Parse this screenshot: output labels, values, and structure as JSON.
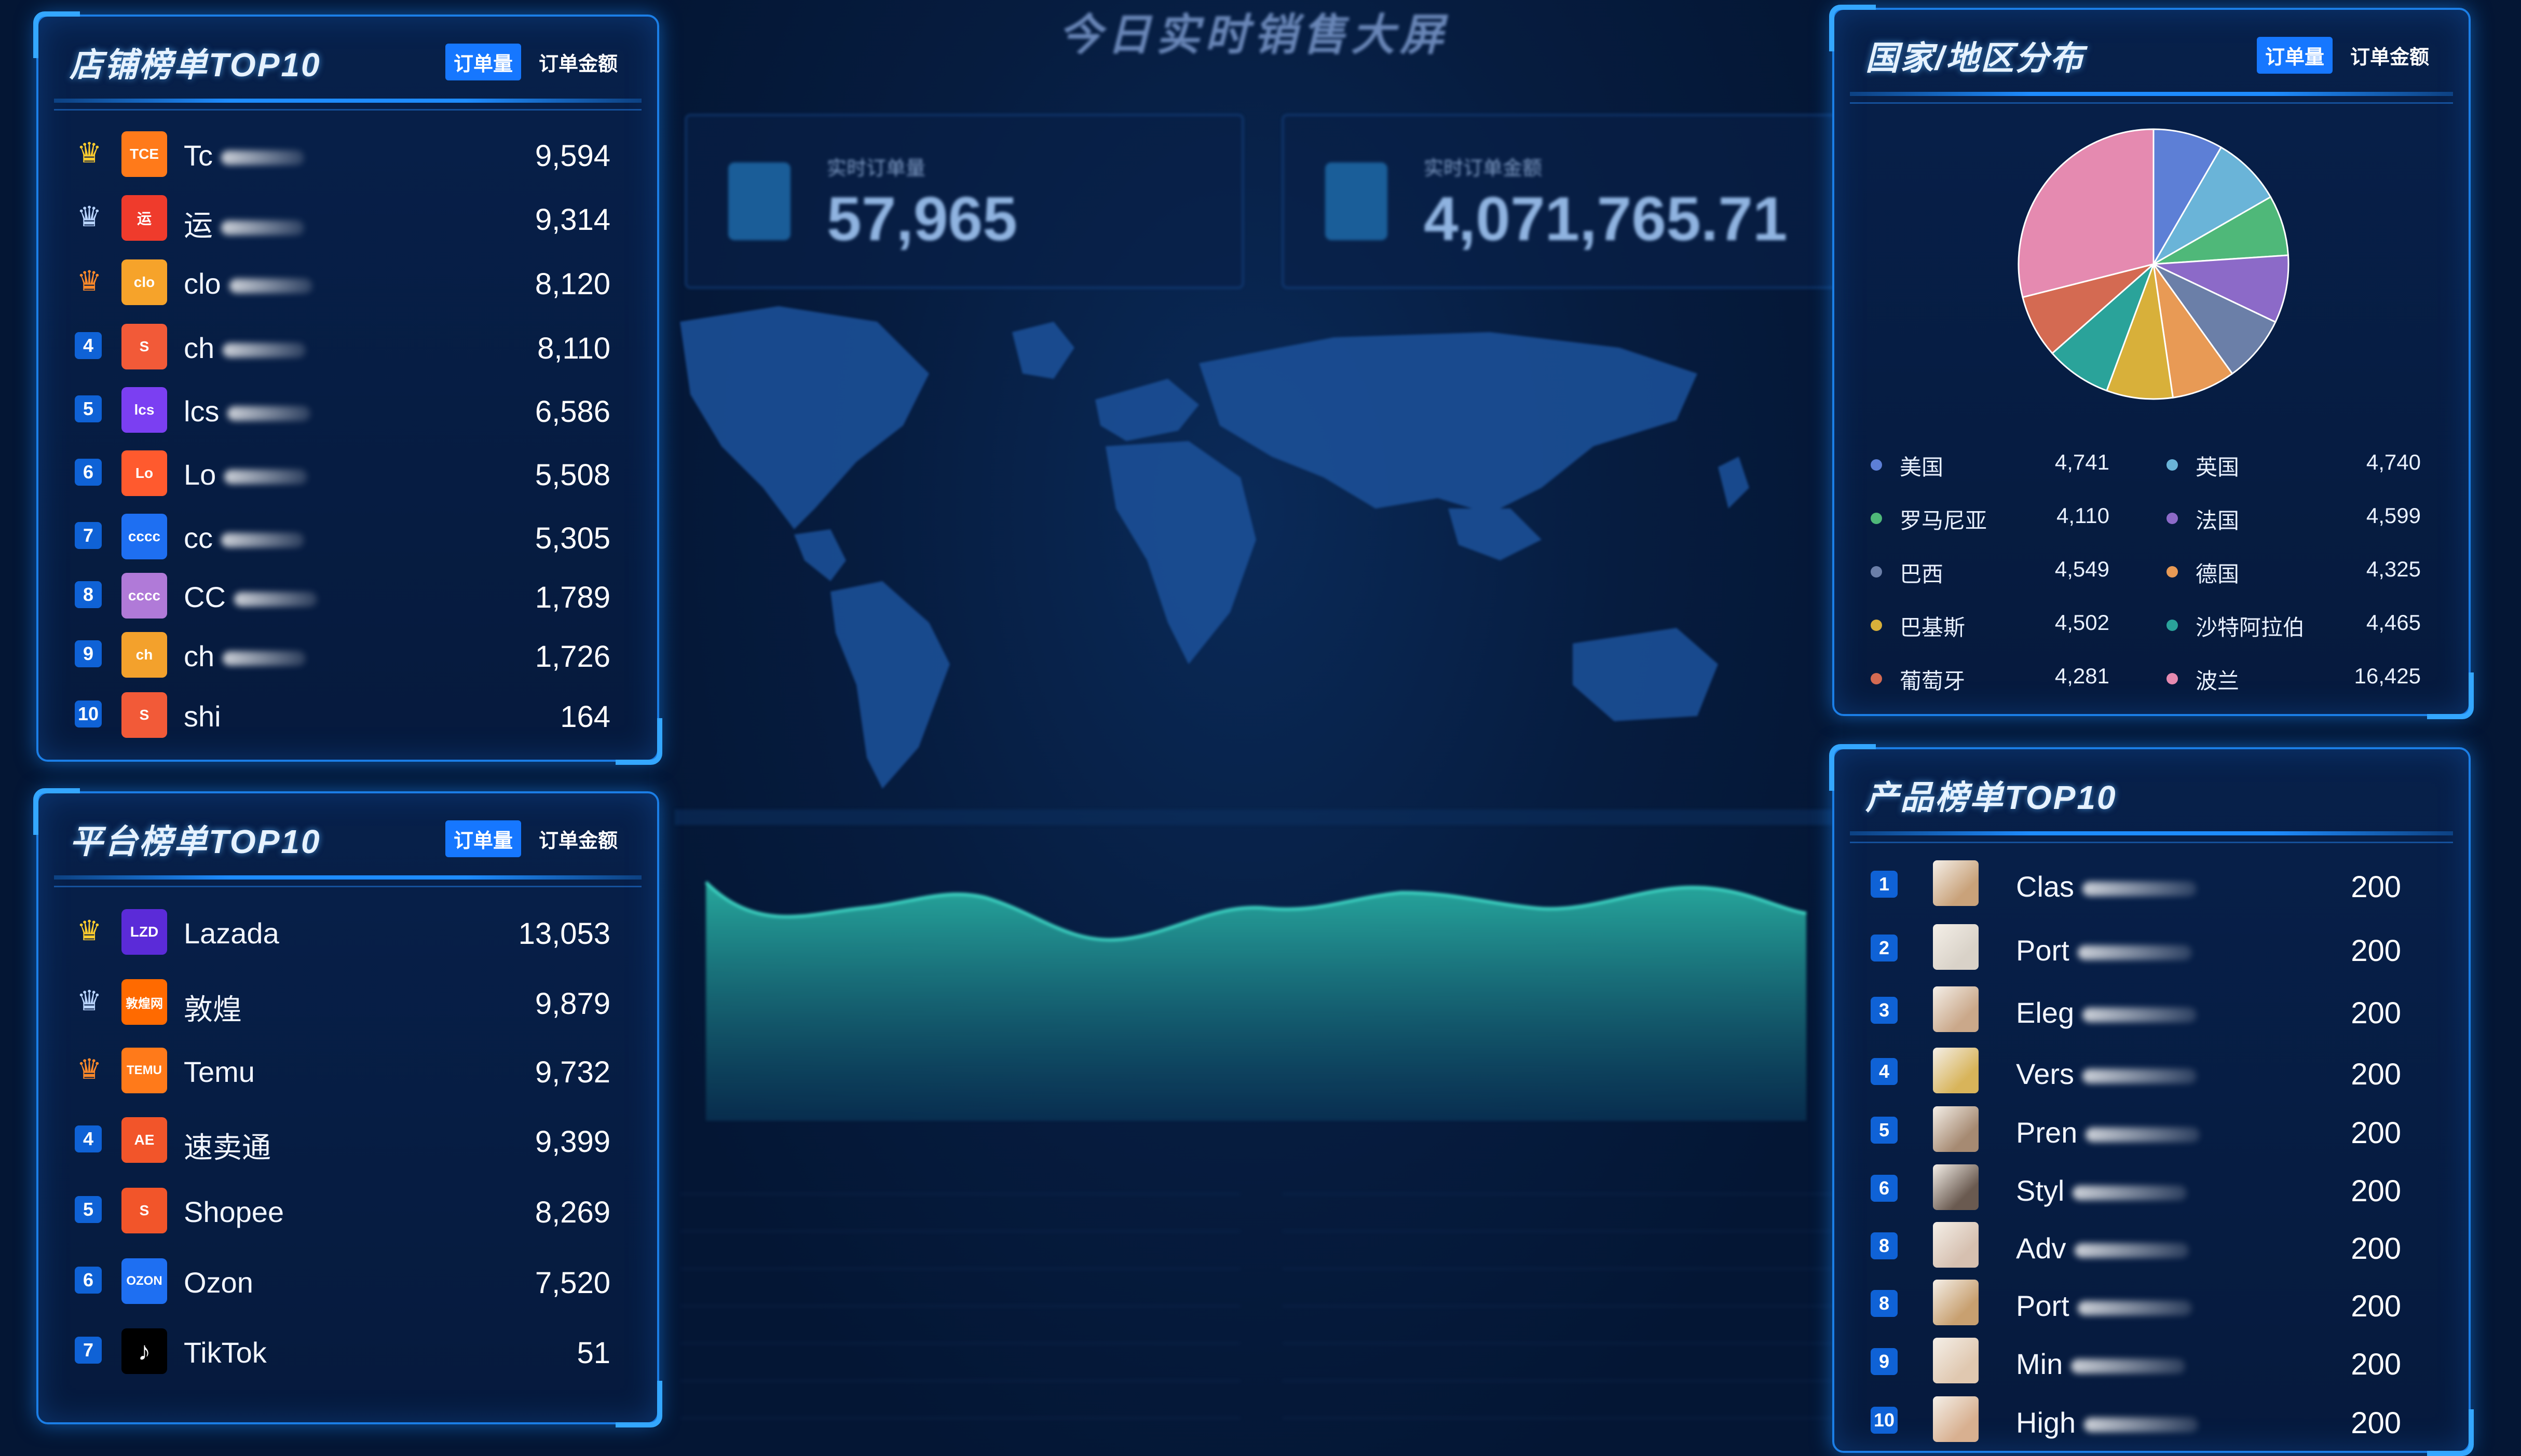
{
  "page_title": "今日实时销售大屏",
  "tabs": {
    "orders": "订单量",
    "amount": "订单金额"
  },
  "kpis": [
    {
      "label": "实时订单量",
      "value": "57,965"
    },
    {
      "label": "实时订单金额",
      "value": "4,071,765.71"
    }
  ],
  "store_panel": {
    "title": "店铺榜单TOP10",
    "rows": [
      {
        "rank": "1",
        "logo": "TCE",
        "name": "Tc",
        "value": "9,594"
      },
      {
        "rank": "2",
        "logo": "运",
        "name": "运",
        "value": "9,314"
      },
      {
        "rank": "3",
        "logo": "clo",
        "name": "clo",
        "value": "8,120"
      },
      {
        "rank": "4",
        "logo": "S",
        "name": "ch",
        "value": "8,110"
      },
      {
        "rank": "5",
        "logo": "lcs",
        "name": "lcs",
        "value": "6,586"
      },
      {
        "rank": "6",
        "logo": "Lo",
        "name": "Lo",
        "value": "5,508"
      },
      {
        "rank": "7",
        "logo": "cccc",
        "name": "cc",
        "value": "5,305"
      },
      {
        "rank": "8",
        "logo": "cccc",
        "name": "CC",
        "value": "1,789"
      },
      {
        "rank": "9",
        "logo": "ch",
        "name": "ch",
        "value": "1,726"
      },
      {
        "rank": "10",
        "logo": "S",
        "name": "shi",
        "value": "164"
      }
    ]
  },
  "platform_panel": {
    "title": "平台榜单TOP10",
    "rows": [
      {
        "rank": "1",
        "logo": "LZD",
        "name": "Lazada",
        "value": "13,053"
      },
      {
        "rank": "2",
        "logo": "敦煌网",
        "name": "敦煌",
        "value": "9,879"
      },
      {
        "rank": "3",
        "logo": "TEMU",
        "name": "Temu",
        "value": "9,732"
      },
      {
        "rank": "4",
        "logo": "AE",
        "name": "速卖通",
        "value": "9,399"
      },
      {
        "rank": "5",
        "logo": "S",
        "name": "Shopee",
        "value": "8,269"
      },
      {
        "rank": "6",
        "logo": "OZON",
        "name": "Ozon",
        "value": "7,520"
      },
      {
        "rank": "7",
        "logo": "♪",
        "name": "TikTok",
        "value": "51"
      }
    ]
  },
  "country_panel": {
    "title": "国家/地区分布",
    "legend": [
      {
        "name": "美国",
        "value": "4,741",
        "color": "#5d7fd6"
      },
      {
        "name": "英国",
        "value": "4,740",
        "color": "#6ab4d8"
      },
      {
        "name": "罗马尼亚",
        "value": "4,110",
        "color": "#4fb879"
      },
      {
        "name": "法国",
        "value": "4,599",
        "color": "#8c6ac8"
      },
      {
        "name": "巴西",
        "value": "4,549",
        "color": "#6b7fa8"
      },
      {
        "name": "德国",
        "value": "4,325",
        "color": "#e89a55"
      },
      {
        "name": "巴基斯",
        "value": "4,502",
        "color": "#d8b03a"
      },
      {
        "name": "沙特阿拉伯",
        "value": "4,465",
        "color": "#2aa39a"
      },
      {
        "name": "葡萄牙",
        "value": "4,281",
        "color": "#d46a52"
      },
      {
        "name": "波兰",
        "value": "16,425",
        "color": "#e58ab0"
      }
    ]
  },
  "product_panel": {
    "title": "产品榜单TOP10",
    "rows": [
      {
        "rank": "1",
        "name": "Clas",
        "value": "200"
      },
      {
        "rank": "2",
        "name": "Port",
        "value": "200"
      },
      {
        "rank": "3",
        "name": "Eleg",
        "value": "200"
      },
      {
        "rank": "4",
        "name": "Vers",
        "value": "200"
      },
      {
        "rank": "5",
        "name": "Pren",
        "value": "200"
      },
      {
        "rank": "6",
        "name": "Styl",
        "value": "200"
      },
      {
        "rank": "8",
        "name": "Adv",
        "value": "200"
      },
      {
        "rank": "8",
        "name": "Port",
        "value": "200"
      },
      {
        "rank": "9",
        "name": "Min",
        "value": "200"
      },
      {
        "rank": "10",
        "name": "High",
        "value": "200"
      }
    ]
  },
  "icons": {
    "gold": "crown-gold-icon",
    "silver": "crown-silver-icon",
    "bronze": "crown-bronze-icon"
  },
  "colors": {
    "accent": "#1677ff",
    "border": "#1b7ee6",
    "bg": "#041634"
  }
}
